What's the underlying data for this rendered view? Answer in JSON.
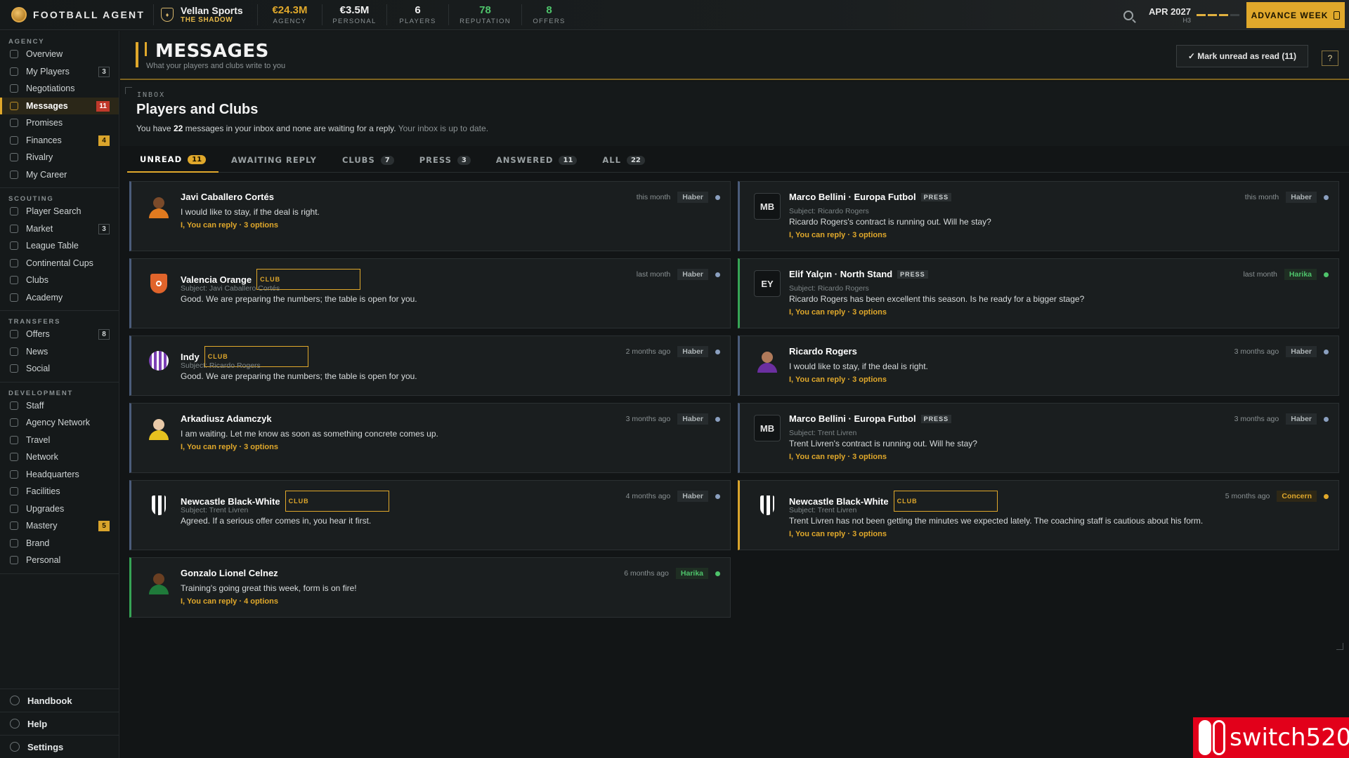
{
  "topbar": {
    "brand": "FOOTBALL AGENT",
    "club_name": "Vellan Sports",
    "club_subtitle": "THE SHADOW",
    "stats": [
      {
        "value": "€24.3M",
        "label": "AGENCY",
        "color": "#e0a82b"
      },
      {
        "value": "€3.5M",
        "label": "PERSONAL",
        "color": "#f0f0f0"
      },
      {
        "value": "6",
        "label": "PLAYERS",
        "color": "#f0f0f0"
      },
      {
        "value": "78",
        "label": "REPUTATION",
        "color": "#4ec46b"
      },
      {
        "value": "8",
        "label": "OFFERS",
        "color": "#4ec46b"
      }
    ],
    "date": "APR 2027",
    "week": "H3",
    "advance_label": "ADVANCE WEEK"
  },
  "sidebar": {
    "sections": [
      {
        "title": "AGENCY",
        "items": [
          {
            "label": "Overview",
            "badge": ""
          },
          {
            "label": "My Players",
            "badge": "3"
          },
          {
            "label": "Negotiations",
            "badge": ""
          },
          {
            "label": "Messages",
            "badge": "11",
            "active": true,
            "badge_style": "red"
          },
          {
            "label": "Promises",
            "badge": ""
          },
          {
            "label": "Finances",
            "badge": "4",
            "badge_style": "gold"
          },
          {
            "label": "Rivalry",
            "badge": ""
          },
          {
            "label": "My Career",
            "badge": ""
          }
        ]
      },
      {
        "title": "SCOUTING",
        "items": [
          {
            "label": "Player Search",
            "badge": ""
          },
          {
            "label": "Market",
            "badge": "3"
          },
          {
            "label": "League Table",
            "badge": ""
          },
          {
            "label": "Continental Cups",
            "badge": ""
          },
          {
            "label": "Clubs",
            "badge": ""
          },
          {
            "label": "Academy",
            "badge": ""
          }
        ]
      },
      {
        "title": "TRANSFERS",
        "items": [
          {
            "label": "Offers",
            "badge": "8"
          },
          {
            "label": "News",
            "badge": ""
          },
          {
            "label": "Social",
            "badge": ""
          }
        ]
      },
      {
        "title": "DEVELOPMENT",
        "items": [
          {
            "label": "Staff",
            "badge": ""
          },
          {
            "label": "Agency Network",
            "badge": ""
          },
          {
            "label": "Travel",
            "badge": ""
          },
          {
            "label": "Network",
            "badge": ""
          },
          {
            "label": "Headquarters",
            "badge": ""
          },
          {
            "label": "Facilities",
            "badge": ""
          },
          {
            "label": "Upgrades",
            "badge": ""
          },
          {
            "label": "Mastery",
            "badge": "5",
            "badge_style": "gold"
          },
          {
            "label": "Brand",
            "badge": ""
          },
          {
            "label": "Personal",
            "badge": ""
          }
        ]
      }
    ],
    "bottom": [
      "Handbook",
      "Help",
      "Settings"
    ]
  },
  "header": {
    "title": "MESSAGES",
    "subtitle": "What your players and clubs write to you",
    "mark_read": "✓ Mark unread as read (11)",
    "help": "?"
  },
  "inbox": {
    "label": "INBOX",
    "title": "Players and Clubs",
    "desc_pre": "You have ",
    "desc_count": "22",
    "desc_post": " messages in your inbox and none are waiting for a reply.",
    "desc_muted": " Your inbox is up to date."
  },
  "tabs": [
    {
      "label": "UNREAD",
      "count": "11",
      "active": true
    },
    {
      "label": "AWAITING REPLY",
      "count": ""
    },
    {
      "label": "CLUBS",
      "count": "7"
    },
    {
      "label": "PRESS",
      "count": "3"
    },
    {
      "label": "ANSWERED",
      "count": "11"
    },
    {
      "label": "ALL",
      "count": "22"
    }
  ],
  "messages": [
    {
      "sender": "Javi Caballero Cortés",
      "tag": "",
      "subject": "",
      "body": "I would like to stay, if the deal is right.",
      "reply": "I, You can reply · 3 options",
      "time": "this month",
      "mood": "Haber",
      "mood_style": "",
      "accent": "",
      "avatar": "player",
      "avatar_color": "#e07a1f",
      "skin": "#7a4a2a"
    },
    {
      "sender": "Marco Bellini · Europa Futbol",
      "tag": "PRESS",
      "subject": "Subject: Ricardo Rogers",
      "body": "Ricardo Rogers's contract is running out. Will he stay?",
      "reply": "I, You can reply · 3 options",
      "time": "this month",
      "mood": "Haber",
      "mood_style": "",
      "accent": "",
      "avatar": "initials",
      "initials": "MB"
    },
    {
      "sender": "Valencia Orange",
      "tag": "CLUB",
      "subject": "Subject: Javi Caballero Cortés",
      "body": "Good. We are preparing the numbers; the table is open for you.",
      "reply": "",
      "time": "last month",
      "mood": "Haber",
      "mood_style": "",
      "accent": "",
      "avatar": "crest",
      "avatar_color": "#e0642b"
    },
    {
      "sender": "Elif Yalçın · North Stand",
      "tag": "PRESS",
      "subject": "Subject: Ricardo Rogers",
      "body": "Ricardo Rogers has been excellent this season. Is he ready for a bigger stage?",
      "reply": "I, You can reply · 3 options",
      "time": "last month",
      "mood": "Harika",
      "mood_style": "good",
      "accent": "green",
      "avatar": "initials",
      "initials": "EY"
    },
    {
      "sender": "Indy",
      "tag": "CLUB",
      "subject": "Subject: Ricardo Rogers",
      "body": "Good. We are preparing the numbers; the table is open for you.",
      "reply": "",
      "time": "2 months ago",
      "mood": "Haber",
      "mood_style": "",
      "accent": "",
      "avatar": "stripes",
      "avatar_color": "#7b3fb5"
    },
    {
      "sender": "Ricardo Rogers",
      "tag": "",
      "subject": "",
      "body": "I would like to stay, if the deal is right.",
      "reply": "I, You can reply · 3 options",
      "time": "3 months ago",
      "mood": "Haber",
      "mood_style": "",
      "accent": "",
      "avatar": "player",
      "avatar_color": "#6b2fa0",
      "skin": "#b07a5a"
    },
    {
      "sender": "Arkadiusz Adamczyk",
      "tag": "",
      "subject": "",
      "body": "I am waiting. Let me know as soon as something concrete comes up.",
      "reply": "I, You can reply · 3 options",
      "time": "3 months ago",
      "mood": "Haber",
      "mood_style": "",
      "accent": "",
      "avatar": "player",
      "avatar_color": "#e6c21f",
      "skin": "#e8c9a8"
    },
    {
      "sender": "Marco Bellini · Europa Futbol",
      "tag": "PRESS",
      "subject": "Subject: Trent Livren",
      "body": "Trent Livren's contract is running out. Will he stay?",
      "reply": "I, You can reply · 3 options",
      "time": "3 months ago",
      "mood": "Haber",
      "mood_style": "",
      "accent": "",
      "avatar": "initials",
      "initials": "MB"
    },
    {
      "sender": "Newcastle Black-White",
      "tag": "CLUB",
      "subject": "Subject: Trent Livren",
      "body": "Agreed. If a serious offer comes in, you hear it first.",
      "reply": "",
      "time": "4 months ago",
      "mood": "Haber",
      "mood_style": "",
      "accent": "",
      "avatar": "stripes-bw",
      "avatar_color": "#ffffff"
    },
    {
      "sender": "Newcastle Black-White",
      "tag": "CLUB",
      "subject": "Subject: Trent Livren",
      "body": "Trent Livren has not been getting the minutes we expected lately. The coaching staff is cautious about his form.",
      "reply": "I, You can reply · 3 options",
      "time": "5 months ago",
      "mood": "Concern",
      "mood_style": "concern",
      "accent": "gold",
      "avatar": "stripes-bw",
      "avatar_color": "#ffffff"
    },
    {
      "sender": "Gonzalo Lionel Celnez",
      "tag": "",
      "subject": "",
      "body": "Training's going great this week, form is on fire!",
      "reply": "I, You can reply · 4 options",
      "time": "6 months ago",
      "mood": "Harika",
      "mood_style": "good",
      "accent": "green",
      "avatar": "player",
      "avatar_color": "#1f7a3a",
      "skin": "#6a3f22"
    }
  ],
  "watermark": "switch520"
}
